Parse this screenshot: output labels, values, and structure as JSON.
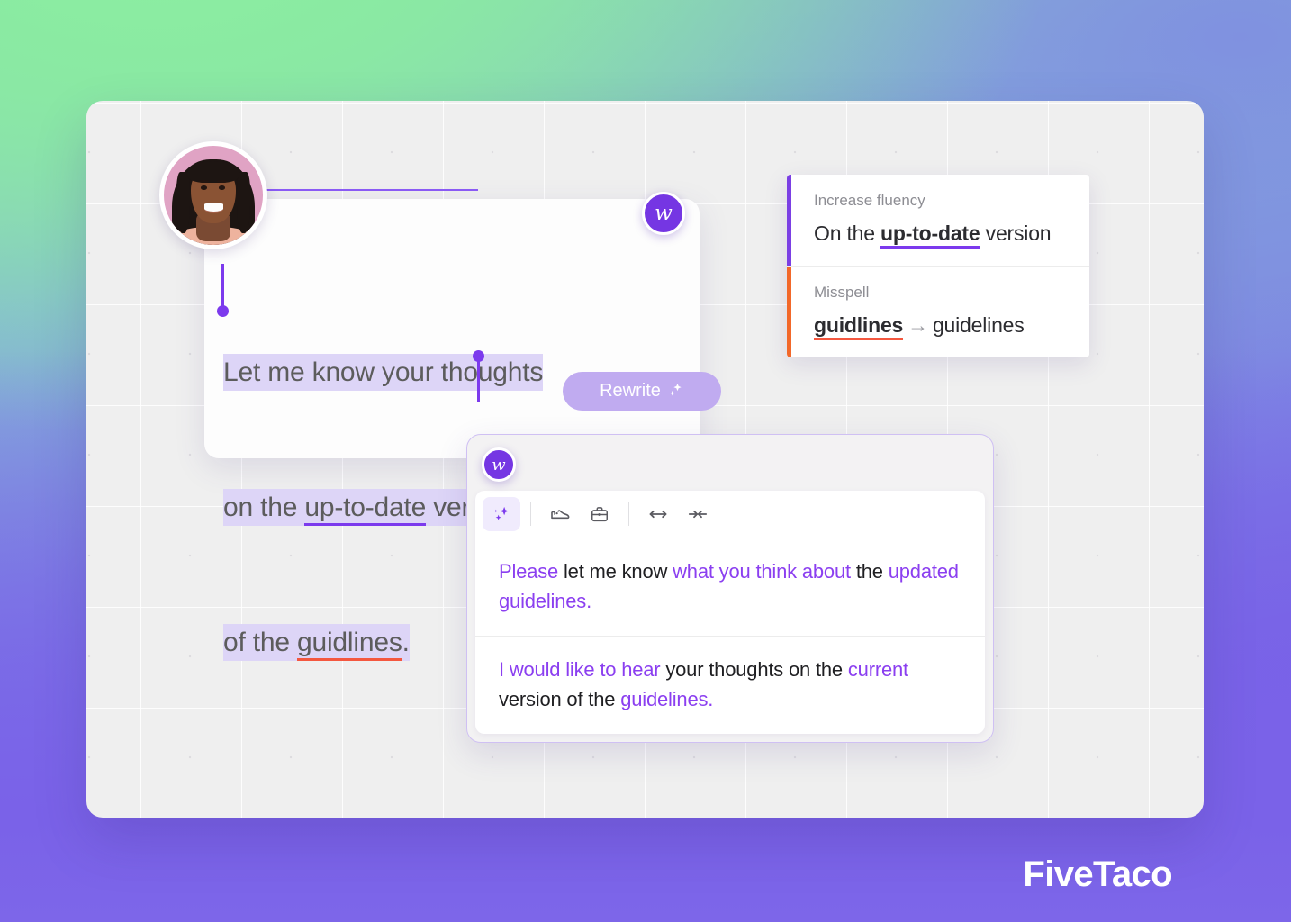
{
  "brand": {
    "name": "FiveTaco"
  },
  "editor": {
    "logo_glyph": "w",
    "logo_name": "writer-logo",
    "text_line1_a": "Let me know your thoughts",
    "text_line2_a": "on the ",
    "text_line2_b": "up-to-date",
    "text_line2_c": " version",
    "text_line3_a": "of the ",
    "text_line3_b": "guidlines",
    "text_line3_c": ".",
    "full_text": "Let me know your thoughts on the up-to-date version of the guidlines.",
    "rewrite_button": "Rewrite",
    "rewrite_button_icon": "sparkle-icon",
    "rewrite_button_glyph": "✦"
  },
  "suggestions": [
    {
      "kind": "Increase fluency",
      "accent": "#7b3fe4",
      "before": "On the ",
      "emphasis": "up-to-date",
      "after": " version"
    },
    {
      "kind": "Misspell",
      "accent": "#f2682a",
      "wrong": "guidlines",
      "arrow": "→",
      "correct": "guidelines"
    }
  ],
  "rewrite_panel": {
    "logo_glyph": "w",
    "toolbar": [
      {
        "name": "sparkle-icon",
        "label": "Magic rewrite",
        "active": true
      },
      {
        "name": "shoe-icon",
        "label": "Casual tone",
        "active": false
      },
      {
        "name": "briefcase-icon",
        "label": "Professional tone",
        "active": false
      },
      {
        "name": "expand-arrows-icon",
        "label": "Make longer",
        "active": false
      },
      {
        "name": "shrink-arrows-icon",
        "label": "Make shorter",
        "active": false
      }
    ],
    "options": [
      {
        "segments": [
          {
            "t": "Please",
            "p": true
          },
          {
            "t": " let me know ",
            "p": false
          },
          {
            "t": "what you think about",
            "p": true
          },
          {
            "t": " the ",
            "p": false
          },
          {
            "t": "updated guidelines.",
            "p": true
          }
        ],
        "plain": "Please let me know what you think about the updated guidelines."
      },
      {
        "segments": [
          {
            "t": "I would like to hear",
            "p": true
          },
          {
            "t": " your thoughts on the ",
            "p": false
          },
          {
            "t": "current",
            "p": true
          },
          {
            "t": " version of the ",
            "p": false
          },
          {
            "t": "guidelines.",
            "p": true
          }
        ],
        "plain": "I would like to hear your thoughts on the current version of the guidelines."
      }
    ]
  },
  "colors": {
    "accent_purple": "#7c3aed",
    "accent_orange": "#f2682a",
    "selection": "#ddd5f7",
    "spell_error": "#f4573f",
    "canvas": "#efefef",
    "brand_purple": "#7a62e8"
  },
  "avatar": {
    "name": "user-avatar",
    "alt": "Smiling woman with braids"
  }
}
